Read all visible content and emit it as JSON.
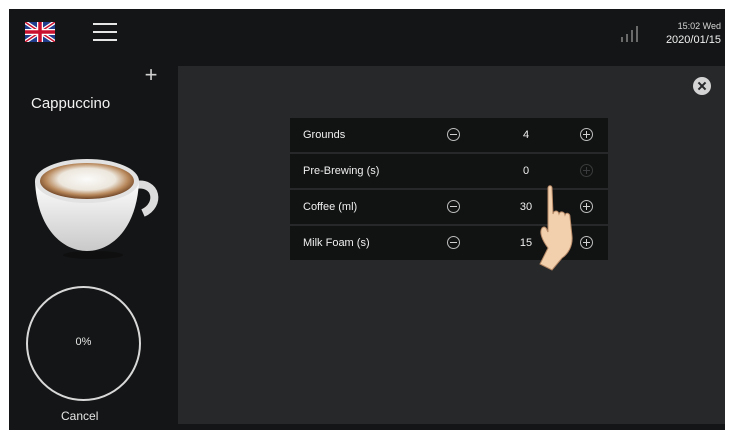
{
  "topbar": {
    "time": "15:02 Wed",
    "date": "2020/01/15",
    "flag_icon": "uk-flag-icon",
    "menu_icon": "hamburger-menu-icon",
    "signal_icon": "signal-strength-icon"
  },
  "drink": {
    "name": "Cappuccino",
    "progress": "0%",
    "cancel_label": "Cancel"
  },
  "settings": [
    {
      "label": "Grounds",
      "value": "4"
    },
    {
      "label": "Pre-Brewing (s)",
      "value": "0"
    },
    {
      "label": "Coffee (ml)",
      "value": "30"
    },
    {
      "label": "Milk Foam (s)",
      "value": "15"
    }
  ],
  "colors": {
    "background": "#141516",
    "panel": "#262829",
    "row": "#111212",
    "text": "#f0f0f0"
  }
}
